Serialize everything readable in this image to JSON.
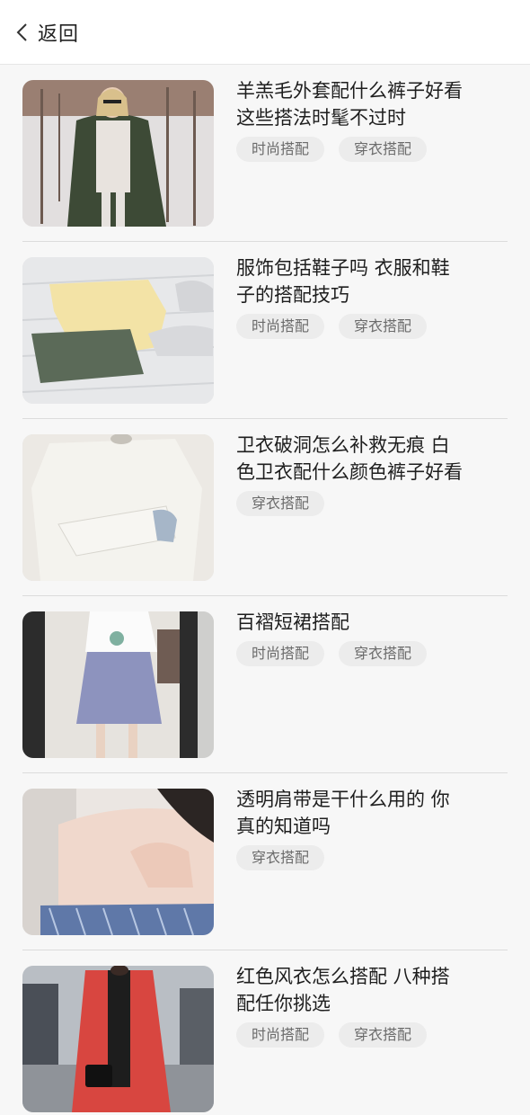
{
  "header": {
    "back_label": "返回",
    "back_icon": "chevron-left-icon"
  },
  "articles": [
    {
      "title_lines": [
        "羊羔毛外套配什么裤子好看",
        "这些搭法时髦不过时"
      ],
      "tags": [
        "时尚搭配",
        "穿衣搭配"
      ],
      "thumb": "woman-in-green-fleece-coat-in-snow"
    },
    {
      "title_lines": [
        "服饰包括鞋子吗 衣服和鞋",
        "子的搭配技巧"
      ],
      "tags": [
        "时尚搭配",
        "穿衣搭配"
      ],
      "thumb": "yellow-top-green-shorts-and-sneakers-flatlay"
    },
    {
      "title_lines": [
        "卫衣破洞怎么补救无痕 白",
        "色卫衣配什么颜色裤子好看"
      ],
      "tags": [
        "穿衣搭配"
      ],
      "thumb": "white-hoodie-with-patched-sleeve"
    },
    {
      "title_lines": [
        "百褶短裙搭配"
      ],
      "tags": [
        "时尚搭配",
        "穿衣搭配"
      ],
      "thumb": "girl-in-white-tee-and-blue-pleated-skirt"
    },
    {
      "title_lines": [
        "透明肩带是干什么用的 你",
        "真的知道吗"
      ],
      "tags": [
        "穿衣搭配"
      ],
      "thumb": "shoulder-with-clear-strap"
    },
    {
      "title_lines": [
        "红色风衣怎么搭配 八种搭",
        "配任你挑选"
      ],
      "tags": [
        "时尚搭配",
        "穿衣搭配"
      ],
      "thumb": "woman-in-red-trench-coat-on-street"
    }
  ]
}
